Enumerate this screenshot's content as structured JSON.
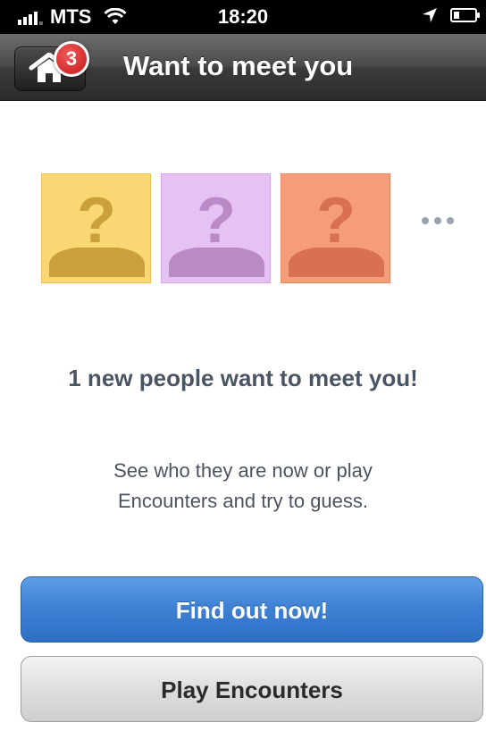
{
  "status_bar": {
    "carrier": "MTS",
    "time": "18:20",
    "icons": [
      "signal-icon",
      "wifi-icon",
      "location-arrow-icon",
      "battery-icon"
    ]
  },
  "nav": {
    "title": "Want to meet you",
    "home_badge": "3",
    "home_icon": "home-icon"
  },
  "tiles": [
    {
      "name": "unknown-person-yellow",
      "color": "#f9d774"
    },
    {
      "name": "unknown-person-purple",
      "color": "#e6c1f3"
    },
    {
      "name": "unknown-person-orange",
      "color": "#f59c78"
    }
  ],
  "main": {
    "headline": "1 new people want to meet you!",
    "subtext_line1": "See who they are now or play",
    "subtext_line2": "Encounters and try to guess."
  },
  "buttons": {
    "find_out": "Find out now!",
    "play_encounters": "Play Encounters"
  },
  "colors": {
    "primary_button": "#3c7fd3",
    "badge": "#c31616"
  }
}
